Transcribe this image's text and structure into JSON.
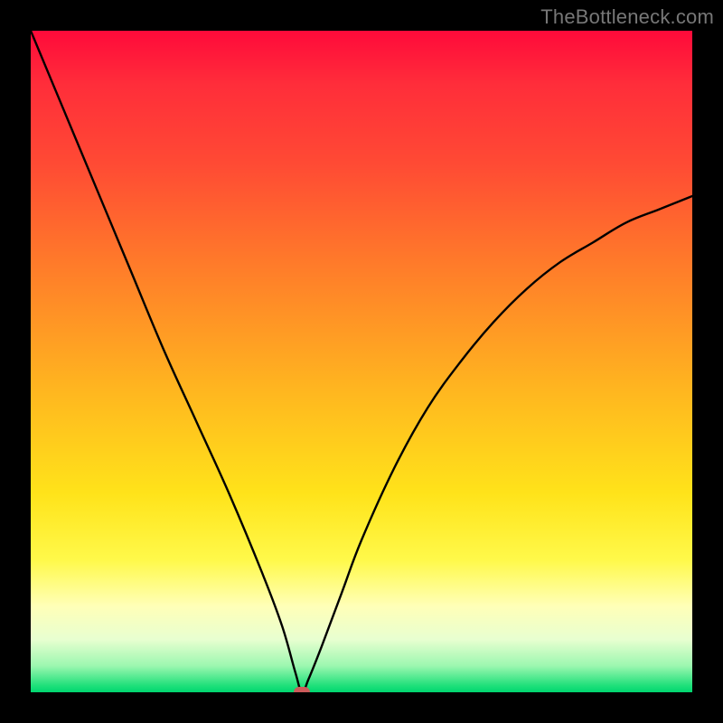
{
  "watermark": "TheBottleneck.com",
  "colors": {
    "curve": "#000000",
    "marker": "#cc5a5a",
    "frame": "#000000"
  },
  "chart_data": {
    "type": "line",
    "title": "",
    "xlabel": "",
    "ylabel": "",
    "xlim": [
      0,
      100
    ],
    "ylim": [
      0,
      100
    ],
    "grid": false,
    "annotations": [
      {
        "name": "min-marker",
        "x": 41,
        "y": 0,
        "shape": "rounded-rect",
        "color": "#cc5a5a"
      }
    ],
    "series": [
      {
        "name": "bottleneck-curve",
        "color": "#000000",
        "x": [
          0,
          5,
          10,
          15,
          20,
          25,
          30,
          35,
          38,
          40,
          41,
          42,
          44,
          47,
          50,
          55,
          60,
          65,
          70,
          75,
          80,
          85,
          90,
          95,
          100
        ],
        "y": [
          100,
          88,
          76,
          64,
          52,
          41,
          30,
          18,
          10,
          3,
          0,
          2,
          7,
          15,
          23,
          34,
          43,
          50,
          56,
          61,
          65,
          68,
          71,
          73,
          75
        ]
      }
    ]
  }
}
